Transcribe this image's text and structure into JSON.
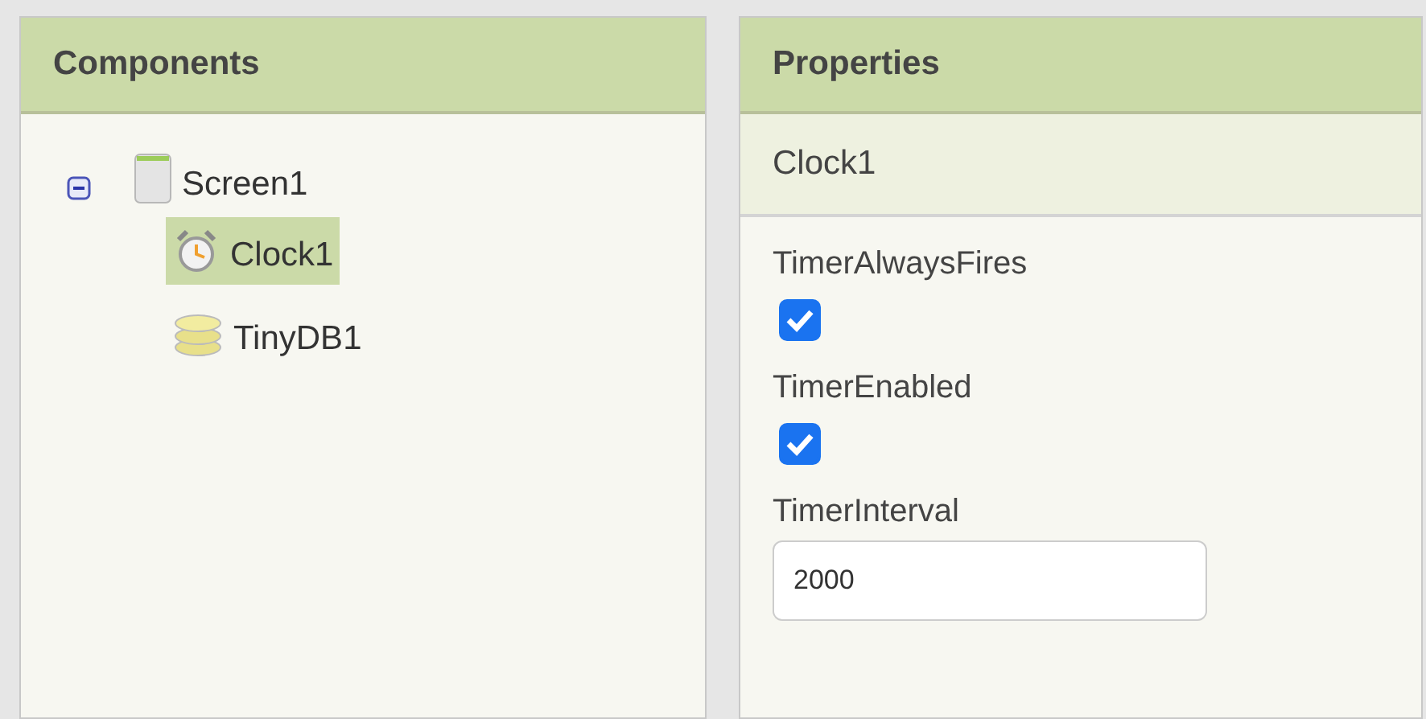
{
  "components": {
    "title": "Components",
    "tree": [
      {
        "label": "Screen1",
        "kind": "screen",
        "expanded": true,
        "selected": false,
        "children": [
          {
            "label": "Clock1",
            "kind": "clock",
            "selected": true
          },
          {
            "label": "TinyDB1",
            "kind": "database",
            "selected": false
          }
        ]
      }
    ]
  },
  "properties": {
    "title": "Properties",
    "component": "Clock1",
    "items": [
      {
        "label": "TimerAlwaysFires",
        "kind": "checkbox",
        "checked": true
      },
      {
        "label": "TimerEnabled",
        "kind": "checkbox",
        "checked": true
      },
      {
        "label": "TimerInterval",
        "kind": "text",
        "value": "2000"
      }
    ]
  }
}
